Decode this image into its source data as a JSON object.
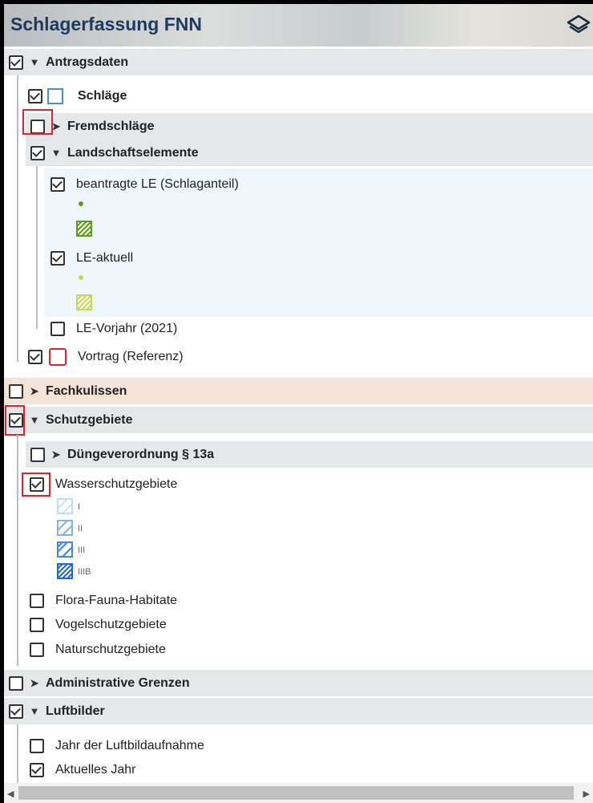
{
  "header": {
    "title": "Schlagerfassung FNN",
    "icon": "layers-icon"
  },
  "tree": {
    "antragsdaten": "Antragsdaten",
    "schlaege": "Schläge",
    "fremdschlaege": "Fremdschläge",
    "landschaftselemente": "Landschaftselemente",
    "beantragte_le": "beantragte LE (Schlaganteil)",
    "le_aktuell": "LE-aktuell",
    "le_vorjahr": "LE-Vorjahr (2021)",
    "vortrag": "Vortrag (Referenz)",
    "fachkulissen": "Fachkulissen",
    "schutzgebiete": "Schutzgebiete",
    "duengeverordnung": "Düngeverordnung § 13a",
    "wasserschutzgebiete": "Wasserschutzgebiete",
    "wsg_legend": [
      "I",
      "II",
      "III",
      "IIIB"
    ],
    "flora_fauna": "Flora-Fauna-Habitate",
    "vogelschutz": "Vogelschutzgebiete",
    "naturschutz": "Naturschutzgebiete",
    "admin_grenzen": "Administrative Grenzen",
    "luftbilder": "Luftbilder",
    "jahr_luftbild": "Jahr der Luftbildaufnahme",
    "aktuelles_jahr": "Aktuelles Jahr"
  },
  "colors": {
    "header_text": "#1e3a5e",
    "group_bg": "#e6e7e8",
    "fachkulissen_bg": "#f3e4d7",
    "le_bg": "#eff7fc",
    "highlight_red": "#e0242f",
    "schlaege_swatch": "#4a8fd4",
    "vortrag_swatch": "#e0242f",
    "le_green_dark": "#5d9a1a",
    "le_green_light": "#c5d85a"
  }
}
